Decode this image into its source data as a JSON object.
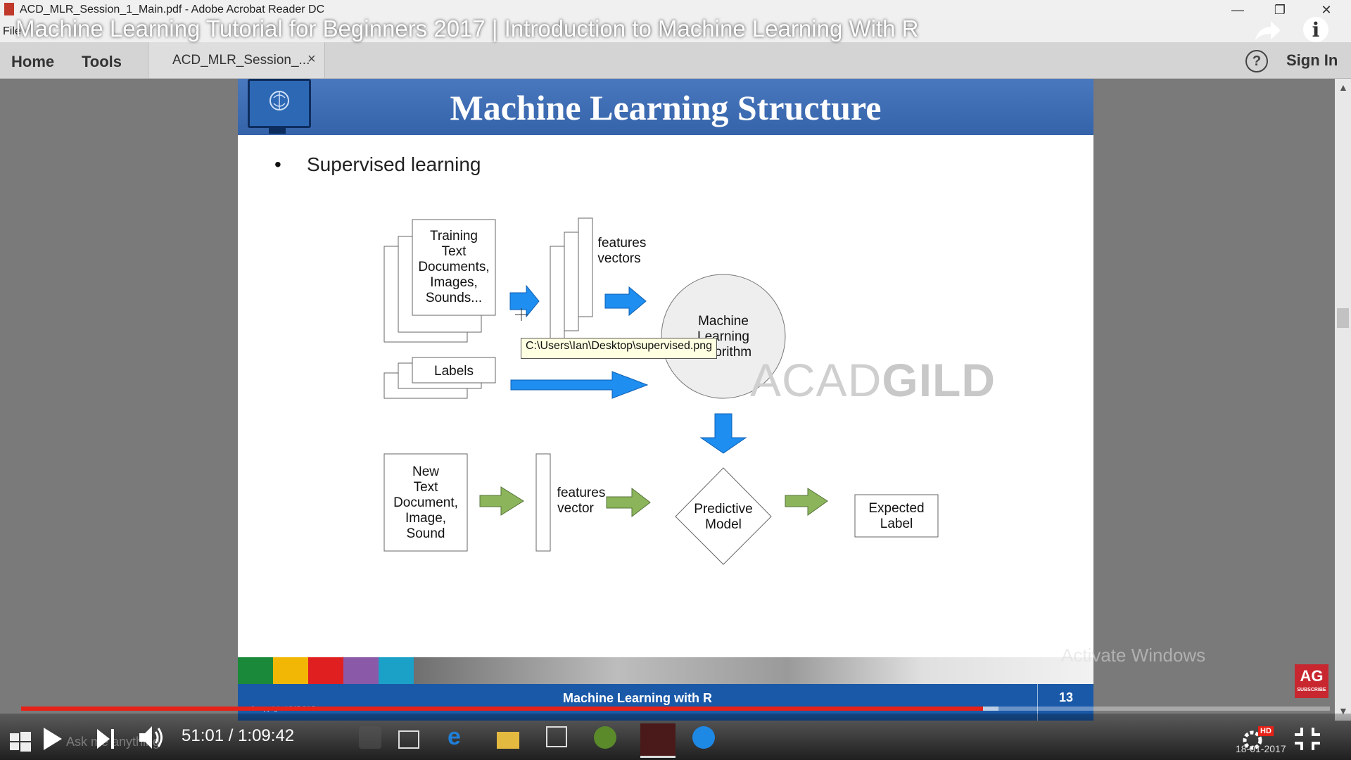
{
  "window": {
    "title": "ACD_MLR_Session_1_Main.pdf - Adobe Acrobat Reader DC",
    "menu_fragment": "File",
    "minimize": "—",
    "restore": "❐",
    "close": "✕"
  },
  "acrobat": {
    "nav": [
      "Home",
      "Tools"
    ],
    "doc_tab_label": "ACD_MLR_Session_...",
    "doc_tab_close": "×",
    "help": "?",
    "sign_in": "Sign In"
  },
  "youtube": {
    "video_title": "Machine Learning Tutorial for Beginners 2017 | Introduction to Machine Learning With R",
    "info": "i",
    "time": "51:01 / 1:09:42",
    "progress_played": 0.735,
    "progress_buffered": 0.747,
    "hd_badge": "HD"
  },
  "slide": {
    "title": "Machine Learning Structure",
    "bullet": "Supervised learning",
    "watermark_light": "ACAD",
    "watermark_bold": "GILD",
    "diagram": {
      "training_box": [
        "Training",
        "Text",
        "Documents,",
        "Images,",
        "Sounds..."
      ],
      "features_vectors": [
        "features",
        "vectors"
      ],
      "labels": "Labels",
      "ml_algorithm": [
        "Machine",
        "Learning",
        "Algorithm"
      ],
      "new_doc": [
        "New",
        "Text",
        "Document,",
        "Image,",
        "Sound"
      ],
      "features_vector": [
        "features",
        "vector"
      ],
      "predictive_model": [
        "Predictive",
        "Model"
      ],
      "expected_label": [
        "Expected",
        "Label"
      ]
    },
    "tooltip": "C:\\Users\\Ian\\Desktop\\supervised.png",
    "footer_title": "Machine Learning with R",
    "page_number": "13",
    "copyright": "© copyright ACADGILD",
    "footer_colors": [
      "#1a8a3a",
      "#f2b705",
      "#e02020",
      "#8a5aa8",
      "#1ba0c8"
    ]
  },
  "os": {
    "activate": "Activate Windows",
    "search_placeholder": "Ask me anything",
    "date": "18-01-2017"
  },
  "badge": {
    "logo": "AG",
    "subscribe": "SUBSCRIBE"
  }
}
